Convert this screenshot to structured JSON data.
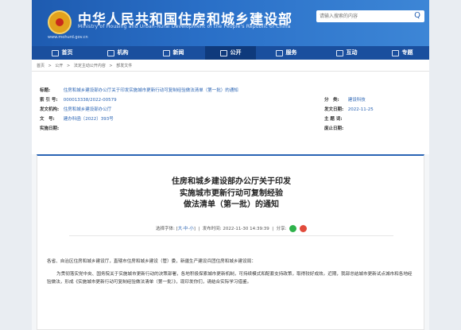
{
  "header": {
    "title": "中华人民共和国住房和城乡建设部",
    "subtitle": "Ministry of Housing and Urban-Rural Development of the People's Republic of China",
    "url": "www.mohurd.gov.cn",
    "search_placeholder": "请输入搜索的内容",
    "search_icon": "Q"
  },
  "nav": {
    "items": [
      {
        "label": "首页",
        "icon": "home-icon"
      },
      {
        "label": "机构",
        "icon": "building-icon"
      },
      {
        "label": "新闻",
        "icon": "news-icon"
      },
      {
        "label": "公开",
        "icon": "disclosure-icon"
      },
      {
        "label": "服务",
        "icon": "service-icon"
      },
      {
        "label": "互动",
        "icon": "interaction-icon"
      },
      {
        "label": "专题",
        "icon": "topic-icon"
      }
    ],
    "active_index": 3
  },
  "breadcrumb": [
    "首页",
    ">",
    "公开",
    ">",
    "法定主动公开内容",
    ">",
    "部发文件"
  ],
  "meta": {
    "subject_label": "标题:",
    "subject_value": "住房和城乡建设部办公厅关于印发实施城市更新行动可复制经验做法清单（第一批）的通知",
    "index_label": "索 引 号:",
    "index_value": "000013338/2022-00579",
    "category_label": "分　类:",
    "category_value": "建设科技",
    "issuer_label": "发文机构:",
    "issuer_value": "住房和城乡建设部办公厅",
    "date_label": "发文日期:",
    "date_value": "2022-11-25",
    "docno_label": "文　号:",
    "docno_value": "建办科函〔2022〕393号",
    "keywords_label": "主 题 词:",
    "keywords_value": "",
    "effective_label": "实施日期:",
    "effective_value": "",
    "expire_label": "废止日期:",
    "expire_value": ""
  },
  "article": {
    "title_line1": "住房和城乡建设部办公厅关于印发",
    "title_line2": "实施城市更新行动可复制经验",
    "title_line3": "做法清单（第一批）的通知",
    "font_label": "选择字体: [",
    "font_large": "大",
    "font_mid": "中",
    "font_small": "小",
    "font_end": "]",
    "publish_time": "发布时间: 2022-11-30 14:39:39",
    "share_label": "分享:",
    "para1": "各省、自治区住房和城乡建设厅，直辖市住房和城乡建设（管）委，新疆生产建设兵团住房和城乡建设局：",
    "para2": "为贯彻落实党中央、国务院关于实施城市更新行动的决策部署，各地积极探索城市更新机制，可持续模式和配套支持政策，取得较好成效。近期，我部总结城市更新试点城市和各地经验做法，形成《实施城市更新行动可复制经验做法清单（第一批）》，现印发你们，请结合实际学习借鉴。"
  }
}
